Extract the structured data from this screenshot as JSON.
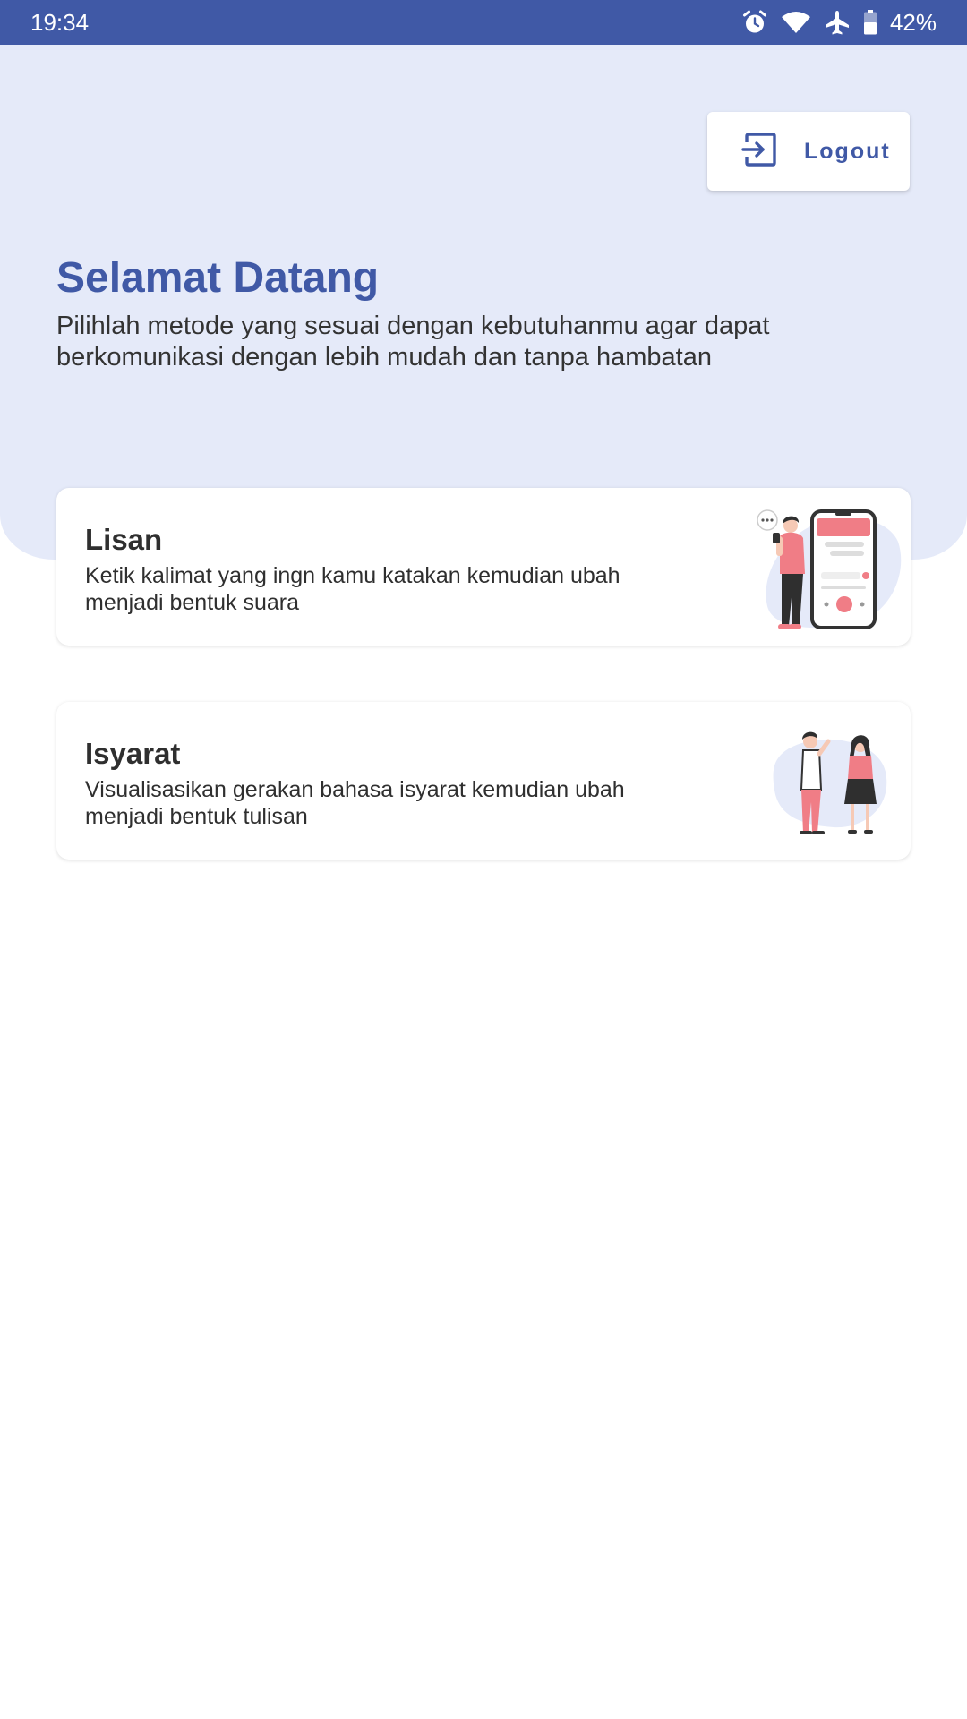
{
  "status_bar": {
    "time": "19:34",
    "icons": [
      "alarm-icon",
      "wifi-icon",
      "airplane-icon",
      "battery-icon"
    ],
    "battery": "42%"
  },
  "header": {
    "logout_label": "Logout",
    "logout_icon": "logout-icon"
  },
  "hero": {
    "title": "Selamat Datang",
    "subtitle": "Pilihlah metode yang sesuai dengan kebutuhanmu agar dapat berkomunikasi dengan lebih mudah dan tanpa hambatan"
  },
  "cards": [
    {
      "title": "Lisan",
      "description": "Ketik kalimat yang ingn kamu katakan kemudian ubah menjadi bentuk suara",
      "illustration": "person-with-phone-illustration"
    },
    {
      "title": "Isyarat",
      "description": "Visualisasikan gerakan bahasa isyarat kemudian ubah menjadi bentuk tulisan",
      "illustration": "two-people-talking-illustration"
    }
  ],
  "colors": {
    "primary": "#4059a6",
    "hero_background": "#e5eaf9",
    "accent": "#f07d86",
    "text": "#2f2f2f"
  }
}
